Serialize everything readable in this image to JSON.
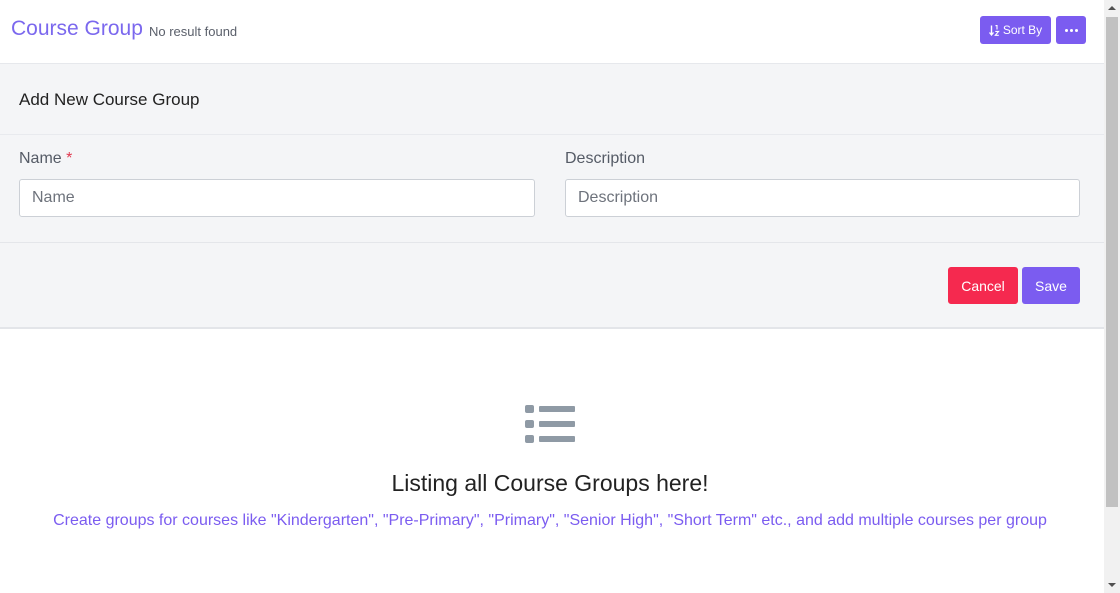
{
  "header": {
    "title": "Course Group",
    "subtitle": "No result found",
    "sort_label": "Sort By",
    "sort_icon": "sort-numeric-icon",
    "more_icon": "ellipsis-icon"
  },
  "form": {
    "title": "Add New Course Group",
    "name_label": "Name",
    "required_mark": "*",
    "name_placeholder": "Name",
    "name_value": "",
    "description_label": "Description",
    "description_placeholder": "Description",
    "description_value": "",
    "cancel_label": "Cancel",
    "save_label": "Save"
  },
  "empty_state": {
    "icon": "list-icon",
    "title": "Listing all Course Groups here!",
    "description": "Create groups for courses like \"Kindergarten\", \"Pre-Primary\", \"Primary\", \"Senior High\", \"Short Term\" etc., and add multiple courses per group"
  },
  "colors": {
    "accent": "#7b5cf0",
    "title": "#7b68ee",
    "danger": "#f5294f",
    "icon_gray": "#8f9aa5"
  }
}
